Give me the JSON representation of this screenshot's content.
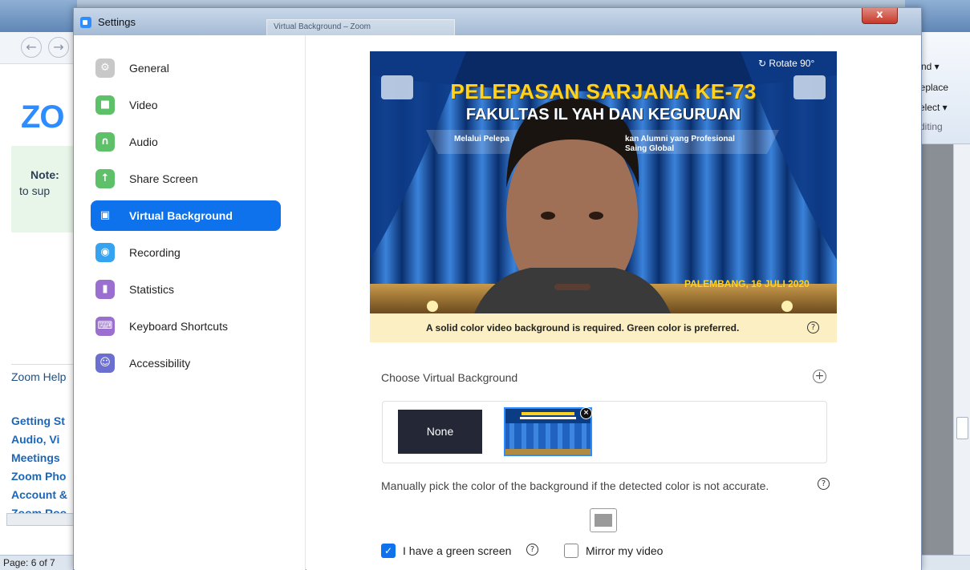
{
  "zoom_window": {
    "title": "Settings",
    "close_glyph": "x",
    "ghost_tab_label": "Virtual Background – Zoom"
  },
  "sidebar": {
    "items": [
      {
        "label": "General",
        "icon": "gear-icon",
        "color": "#c8c8c8"
      },
      {
        "label": "Video",
        "icon": "video-camera-icon",
        "color": "#5fc06a"
      },
      {
        "label": "Audio",
        "icon": "headphones-icon",
        "color": "#5fc06a"
      },
      {
        "label": "Share Screen",
        "icon": "share-screen-icon",
        "color": "#5fc06a"
      },
      {
        "label": "Virtual Background",
        "icon": "person-portrait-icon",
        "color": "#0e72ed"
      },
      {
        "label": "Recording",
        "icon": "record-icon",
        "color": "#35a3ef"
      },
      {
        "label": "Statistics",
        "icon": "bar-chart-icon",
        "color": "#9a6fd0"
      },
      {
        "label": "Keyboard Shortcuts",
        "icon": "keyboard-icon",
        "color": "#9a6fd0"
      },
      {
        "label": "Accessibility",
        "icon": "accessibility-icon",
        "color": "#6a6fd0"
      }
    ],
    "active_index": 4
  },
  "preview": {
    "rotate_label": "Rotate 90°",
    "background_title_1": "PELEPASAN SARJANA KE-73",
    "background_title_2": "FAKULTAS IL          YAH DAN KEGURUAN",
    "background_sub_1": "Melalui Pelepa",
    "background_sub_2": "kan Alumni yang Profesional",
    "background_sub_3": "Saing Global",
    "background_date": "PALEMBANG, 16 JULI 2020",
    "notice": "A solid color video background is required. Green color is preferred."
  },
  "choose": {
    "label": "Choose Virtual Background",
    "none_label": "None",
    "thumb_title": "PELEPASAN SARJANA KE-73"
  },
  "manual": {
    "text": "Manually pick the color of the background if the detected color is not accurate.",
    "picked_color": "#9a9a9a"
  },
  "options": {
    "green_screen_label": "I have a green screen",
    "green_screen_checked": true,
    "mirror_label": "Mirror my video",
    "mirror_checked": false
  },
  "background_windows": {
    "zoom_logo": "ZO",
    "note_1": "Note:",
    "note_2": "to sup",
    "help_header": "Zoom Help",
    "help_links": [
      "Getting St",
      "Audio, Vi",
      "Meetings",
      "Zoom Pho",
      "Account &",
      "Zoom Roo"
    ],
    "status_page": "Page: 6 of 7",
    "ribbon_find": "Find ▾",
    "ribbon_replace": "Replace",
    "ribbon_select": "Select ▾",
    "ribbon_group": "Editing"
  }
}
